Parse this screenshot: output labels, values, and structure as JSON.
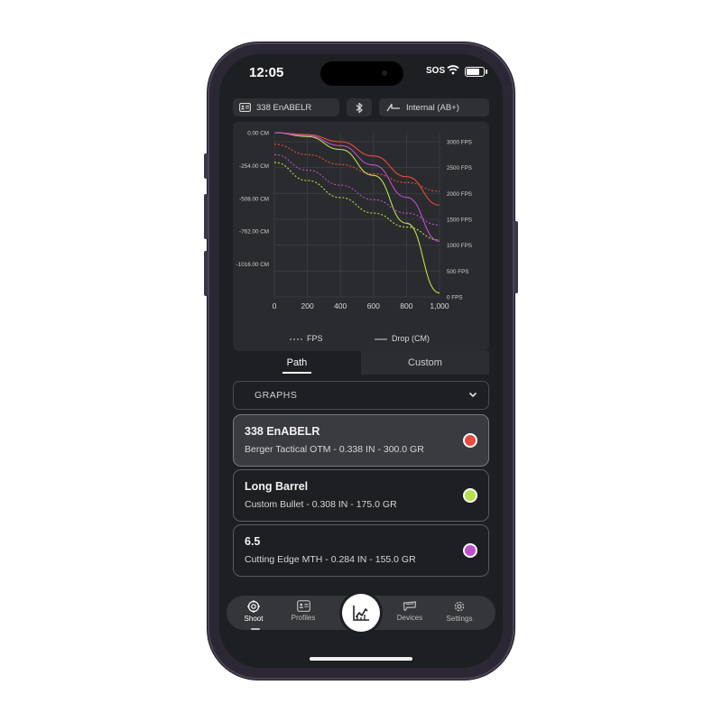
{
  "status_bar": {
    "time": "12:05",
    "carrier": "SOS",
    "battery_level": 0.8
  },
  "top_bar": {
    "profile_label": "338 EnABELR",
    "connection_label": "Internal (AB+)"
  },
  "chart_data": {
    "type": "line",
    "x": [
      0,
      200,
      400,
      600,
      800,
      1000
    ],
    "x_tick_labels": [
      "0",
      "200",
      "400",
      "600",
      "800",
      "1,000"
    ],
    "left_axis": {
      "label": "Drop (CM)",
      "ticks": [
        "0.00 CM",
        "-254.00 CM",
        "-508.00 CM",
        "-762.00 CM",
        "-1016.00 CM"
      ],
      "ylim": [
        -1270,
        0
      ]
    },
    "right_axis": {
      "label": "FPS",
      "ticks": [
        "3000 FPS",
        "2500 FPS",
        "2000 FPS",
        "1500 FPS",
        "1000 FPS",
        "500 FPS",
        "0 FPS"
      ],
      "ylim": [
        0,
        3000
      ]
    },
    "grid": true,
    "legend": [
      "FPS",
      "Drop (CM)"
    ],
    "series": [
      {
        "color": "#e74c3c",
        "kind": "drop",
        "values": [
          0,
          -15,
          -70,
          -180,
          -340,
          -560
        ]
      },
      {
        "color": "#e74c3c",
        "kind": "fps",
        "values": [
          2950,
          2750,
          2560,
          2380,
          2210,
          2040
        ]
      },
      {
        "color": "#b8e04a",
        "kind": "drop",
        "values": [
          0,
          -30,
          -130,
          -330,
          -700,
          -1240
        ]
      },
      {
        "color": "#b8e04a",
        "kind": "fps",
        "values": [
          2600,
          2250,
          1920,
          1620,
          1350,
          1100
        ]
      },
      {
        "color": "#c04fd0",
        "kind": "drop",
        "values": [
          0,
          -22,
          -100,
          -250,
          -500,
          -840
        ]
      },
      {
        "color": "#c04fd0",
        "kind": "fps",
        "values": [
          2750,
          2450,
          2160,
          1880,
          1620,
          1390
        ]
      }
    ]
  },
  "chart_legend": {
    "fps_label": "FPS",
    "drop_label": "Drop (CM)"
  },
  "tabs": {
    "path": "Path",
    "custom": "Custom"
  },
  "graphs_select": {
    "label": "GRAPHS"
  },
  "profiles": [
    {
      "title": "338 EnABELR",
      "subtitle": "Berger Tactical OTM - 0.338 IN - 300.0 GR",
      "color": "#e74c3c",
      "selected": true
    },
    {
      "title": "Long Barrel",
      "subtitle": "Custom Bullet - 0.308 IN - 175.0 GR",
      "color": "#b8e04a",
      "selected": false
    },
    {
      "title": "6.5",
      "subtitle": "Cutting Edge MTH - 0.284 IN - 155.0 GR",
      "color": "#c04fd0",
      "selected": false
    }
  ],
  "tab_bar": {
    "shoot": "Shoot",
    "profiles": "Profiles",
    "devices": "Devices",
    "settings": "Settings"
  },
  "icons": {
    "profile_chip": "id-card-icon",
    "bluetooth": "bluetooth-icon",
    "connection": "signal-icon",
    "center": "chart-icon"
  }
}
